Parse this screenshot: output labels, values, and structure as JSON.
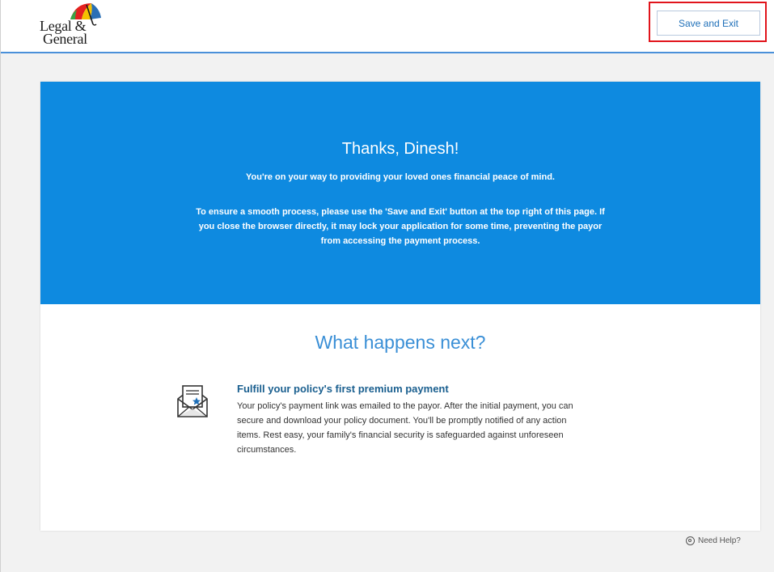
{
  "header": {
    "logo_line1": "Legal &",
    "logo_line2": "General",
    "save_exit_label": "Save and Exit"
  },
  "hero": {
    "title": "Thanks, Dinesh!",
    "subtitle": "You're on your way to providing your loved ones financial peace of mind.",
    "note": "To ensure a smooth process, please use the 'Save and Exit' button at the top right of this page. If you close the browser directly, it may lock your application for some time, preventing the payor from accessing the payment process."
  },
  "next": {
    "title": "What happens next?",
    "step_title": "Fulfill your policy's first premium payment",
    "step_body": "Your policy's payment link was emailed to the payor. After the initial payment, you can secure and download your policy document. You'll be promptly notified of any action items. Rest easy, your family's financial security is safeguarded against unforeseen circumstances.",
    "step_icon": "mail-envelope-icon"
  },
  "footer": {
    "help_label": "Need Help?"
  },
  "colors": {
    "hero_blue": "#0e8ae0",
    "accent_blue": "#3a8fd6",
    "highlight_red": "#e1141b"
  }
}
